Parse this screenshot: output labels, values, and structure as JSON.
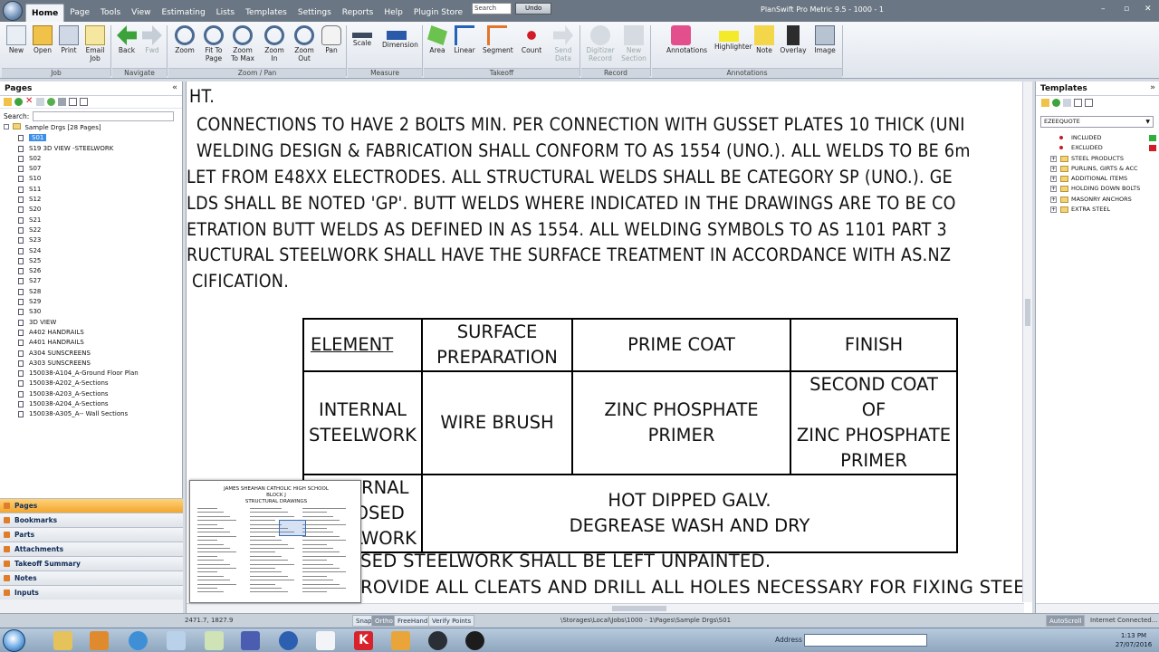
{
  "app": {
    "title": "PlanSwift Pro Metric 9.5 - 1000 - 1"
  },
  "menu": [
    "Home",
    "Page",
    "Tools",
    "View",
    "Estimating",
    "Lists",
    "Templates",
    "Settings",
    "Reports",
    "Help",
    "Plugin Store"
  ],
  "search_placeholder": "Search",
  "undo_label": "Undo",
  "window_controls": [
    "–",
    "▫",
    "✕"
  ],
  "ribbon": {
    "buttons": [
      {
        "label": "New"
      },
      {
        "label": "Open"
      },
      {
        "label": "Print"
      },
      {
        "label": "Email\nJob"
      },
      {
        "label": "Back"
      },
      {
        "label": "Fwd"
      },
      {
        "label": "Zoom"
      },
      {
        "label": "Fit To\nPage"
      },
      {
        "label": "Zoom\nTo Max"
      },
      {
        "label": "Zoom\nIn"
      },
      {
        "label": "Zoom\nOut"
      },
      {
        "label": "Pan"
      },
      {
        "label": "Scale"
      },
      {
        "label": "Dimension"
      },
      {
        "label": "Area"
      },
      {
        "label": "Linear"
      },
      {
        "label": "Segment"
      },
      {
        "label": "Count"
      },
      {
        "label": "Send\nData"
      },
      {
        "label": "Digitizer\nRecord"
      },
      {
        "label": "New\nSection"
      },
      {
        "label": "Annotations"
      },
      {
        "label": "Highlighter"
      },
      {
        "label": "Note"
      },
      {
        "label": "Overlay"
      },
      {
        "label": "Image"
      }
    ],
    "groups": [
      "Job",
      "Navigate",
      "Zoom / Pan",
      "Measure",
      "Takeoff",
      "Record",
      "Annotations"
    ]
  },
  "left_panel": {
    "title": "Pages",
    "search_label": "Search:",
    "root": "Sample Drgs [28 Pages]",
    "pages": [
      "S01",
      "S19 3D VIEW -STEELWORK",
      "S02",
      "S07",
      "S10",
      "S11",
      "S12",
      "S20",
      "S21",
      "S22",
      "S23",
      "S24",
      "S25",
      "S26",
      "S27",
      "S28",
      "S29",
      "S30",
      "3D VIEW",
      "A402 HANDRAILS",
      "A401 HANDRAILS",
      "A304 SUNSCREENS",
      "A303 SUNSCREENS",
      "150038-A104_A-Ground Floor Plan",
      "150038-A202_A-Sections",
      "150038-A203_A-Sections",
      "150038-A204_A-Sections",
      "150038-A305_A-- Wall Sections"
    ],
    "nav_tabs": [
      "Pages",
      "Bookmarks",
      "Parts",
      "Attachments",
      "Takeoff Summary",
      "Notes",
      "Inputs"
    ]
  },
  "document": {
    "lines": [
      "HT.",
      "CONNECTIONS TO HAVE 2 BOLTS MIN. PER CONNECTION WITH GUSSET PLATES 10 THICK (UNI",
      "WELDING DESIGN & FABRICATION SHALL CONFORM TO AS 1554 (UNO.). ALL WELDS TO BE 6m",
      "LET FROM E48XX ELECTRODES. ALL STRUCTURAL WELDS SHALL BE CATEGORY SP (UNO.). GE",
      "LDS SHALL BE NOTED 'GP'. BUTT WELDS WHERE INDICATED IN THE DRAWINGS ARE TO BE CO",
      "ETRATION BUTT WELDS AS DEFINED IN AS 1554. ALL WELDING SYMBOLS TO AS 1101 PART 3",
      "RUCTURAL STEELWORK SHALL HAVE THE SURFACE TREATMENT IN ACCORDANCE WITH AS.NZ",
      "CIFICATION."
    ],
    "table": {
      "headers": [
        "ELEMENT",
        "SURFACE\nPREPARATION",
        "PRIME COAT",
        "FINISH"
      ],
      "row1": [
        "INTERNAL\nSTEELWORK",
        "WIRE BRUSH",
        "ZINC PHOSPHATE\nPRIMER",
        "SECOND COAT OF\nZINC PHOSPHATE\nPRIMER"
      ],
      "row2": [
        "EXTERNAL\nEXPOSED\nSTEELWORK",
        "HOT DIPPED GALV.\nDEGREASE WASH AND DRY"
      ]
    },
    "bottom_lines": [
      "SED STEELWORK SHALL BE LEFT UNPAINTED.",
      "ROVIDE ALL CLEATS AND DRILL ALL HOLES NECESSARY FOR FIXING STEE"
    ]
  },
  "thumbnail": {
    "title": "JAMES SHEAHAN CATHOLIC HIGH SCHOOL\nBLOCK J\nSTRUCTURAL DRAWINGS"
  },
  "right_panel": {
    "title": "Templates",
    "selected_template": "EZEEQUOTE",
    "items": [
      {
        "label": "INCLUDED",
        "kind": "dot",
        "swatch": "#2fae3a"
      },
      {
        "label": "EXCLUDED",
        "kind": "dot",
        "swatch": "#d21d28"
      },
      {
        "label": "STEEL PRODUCTS",
        "kind": "folder"
      },
      {
        "label": "PURLINS, GIRTS & ACC",
        "kind": "folder"
      },
      {
        "label": "ADDITIONAL ITEMS",
        "kind": "folder"
      },
      {
        "label": "HOLDING DOWN BOLTS",
        "kind": "folder"
      },
      {
        "label": "MASONRY ANCHORS",
        "kind": "folder"
      },
      {
        "label": "EXTRA STEEL",
        "kind": "folder"
      }
    ]
  },
  "statusbar": {
    "coords": "2471.7, 1827.9",
    "toggles": [
      "Snap",
      "Ortho",
      "FreeHand",
      "Verify Points"
    ],
    "path": "\\Storages\\Local\\Jobs\\1000 - 1\\Pages\\Sample Drgs\\S01",
    "autoscroll": "AutoScroll",
    "connection": "Internet Connected..."
  },
  "taskbar": {
    "address_label": "Address",
    "time": "1:13 PM",
    "date": "27/07/2016"
  },
  "colors": {
    "accent": "#f3a62f",
    "selection": "#3b8fe8",
    "titlebar": "#6a7683"
  }
}
